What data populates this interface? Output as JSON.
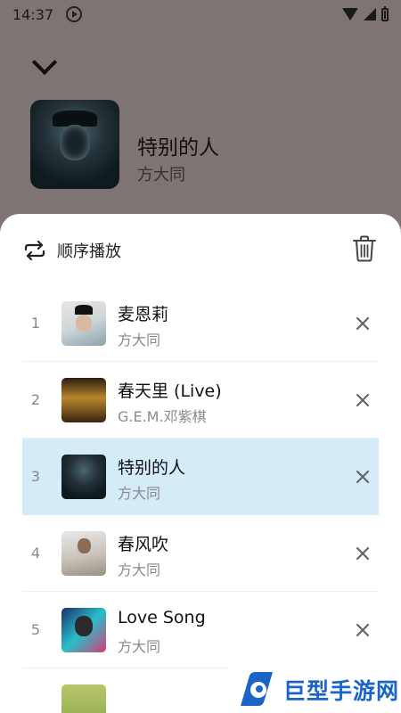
{
  "status_bar": {
    "time": "14:37",
    "media_icon": "play-circle-icon",
    "wifi_icon": "wifi-icon",
    "signal_icon": "cellular-signal-icon",
    "battery_icon": "battery-icon"
  },
  "player": {
    "collapse_icon": "chevron-down-icon",
    "now_playing": {
      "title": "特别的人",
      "artist": "方大同"
    }
  },
  "playlist": {
    "mode_icon": "repeat-icon",
    "mode_label": "顺序播放",
    "clear_icon": "trash-icon",
    "songs": [
      {
        "index": "1",
        "title": "麦恩莉",
        "artist": "方大同"
      },
      {
        "index": "2",
        "title": "春天里 (Live)",
        "artist": "G.E.M.邓紫棋"
      },
      {
        "index": "3",
        "title": "特别的人",
        "artist": "方大同",
        "active": true
      },
      {
        "index": "4",
        "title": "春风吹",
        "artist": "方大同"
      },
      {
        "index": "5",
        "title": "Love Song",
        "artist": "方大同"
      }
    ],
    "remove_icon": "close-icon",
    "active_color": "#d4ebf8"
  },
  "watermark": {
    "text": "巨型手游网",
    "color": "#1a64c8"
  },
  "colors": {
    "backdrop": "#7e7473",
    "sheet": "#ffffff"
  }
}
